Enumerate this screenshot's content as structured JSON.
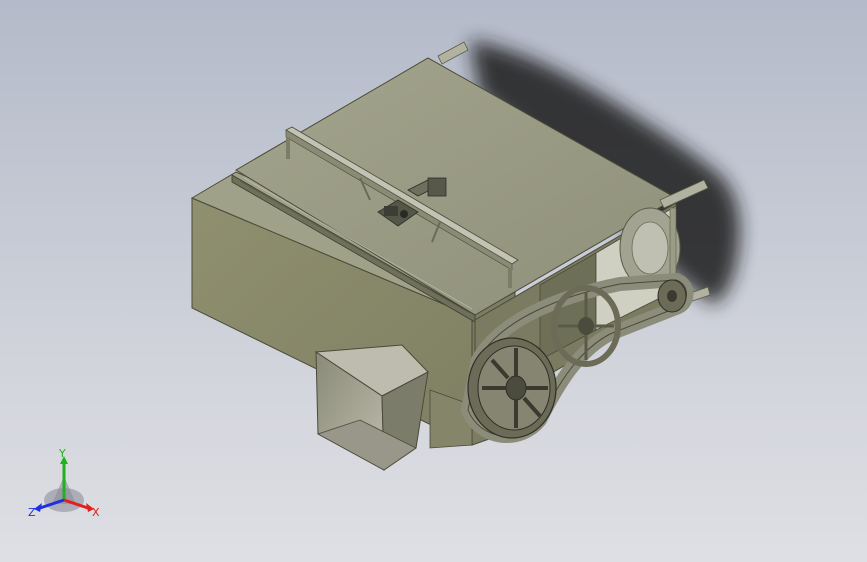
{
  "viewport": {
    "background_top": "#b4bac9",
    "background_bottom": "#dedfe4"
  },
  "model": {
    "kind": "belt-driven-machine-assembly",
    "colors": {
      "housing_front": "#898a6e",
      "housing_side": "#7d7e64",
      "top_plate": "#9a9b83",
      "hopper": "#a09f8e",
      "rail": "#b1b2a0",
      "pulley": "#6b6b58",
      "belt": "#8c8c7a",
      "shadow": "#1c1c1c"
    }
  },
  "triad": {
    "x_label": "X",
    "y_label": "Y",
    "z_label": "Z",
    "x_color": "#e02020",
    "y_color": "#20b020",
    "z_color": "#2030e0"
  }
}
